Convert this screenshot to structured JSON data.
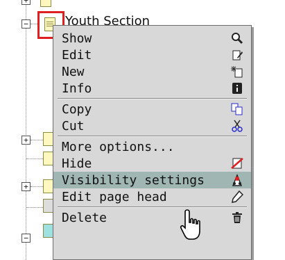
{
  "tree": {
    "top_node_label": "Youth Section"
  },
  "context_menu": {
    "items": [
      {
        "label": "Show",
        "icon": "magnifier-icon"
      },
      {
        "label": "Edit",
        "icon": "edit-page-icon"
      },
      {
        "label": "New",
        "icon": "new-page-icon"
      },
      {
        "label": "Info",
        "icon": "info-icon"
      },
      {
        "label": "Copy",
        "icon": "copy-icon"
      },
      {
        "label": "Cut",
        "icon": "scissors-icon"
      },
      {
        "label": "More options...",
        "icon": ""
      },
      {
        "label": "Hide",
        "icon": "hidden-icon"
      },
      {
        "label": "Visibility settings",
        "icon": "visibility-settings-icon"
      },
      {
        "label": "Edit page head",
        "icon": "pencil-icon"
      },
      {
        "label": "Delete",
        "icon": "trash-icon"
      }
    ],
    "highlighted_index": 8,
    "colors": {
      "background": "#d8d8d8",
      "highlight": "#9fb6b3",
      "selection_border": "#e02020"
    }
  }
}
